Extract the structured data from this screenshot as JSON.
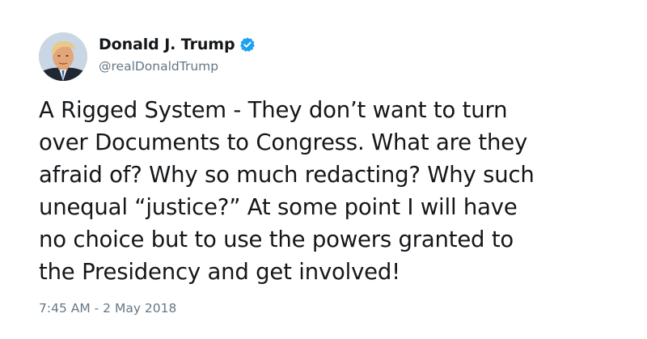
{
  "author": {
    "display_name": "Donald J. Trump",
    "handle": "@realDonaldTrump",
    "verified": true,
    "verified_icon": "verified-badge-icon",
    "avatar": "profile-photo"
  },
  "tweet": {
    "text": "A Rigged System - They don’t want to turn\nover Documents to Congress. What are they\nafraid of? Why so much redacting? Why such\nunequal “justice?” At some point I will have\nno choice but to use the powers granted to\nthe Presidency and get involved!",
    "timestamp": "7:45 AM - 2 May 2018"
  },
  "colors": {
    "text_primary": "#14171a",
    "text_secondary": "#657786",
    "verified_blue": "#1da1f2",
    "background": "#ffffff"
  }
}
